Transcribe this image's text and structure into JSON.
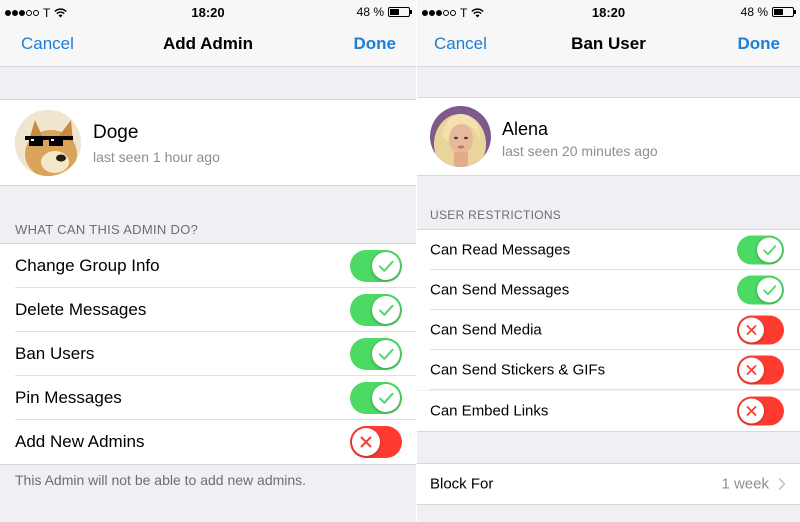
{
  "left": {
    "status": {
      "carrier": "T",
      "time": "18:20",
      "battery": "48 %"
    },
    "nav": {
      "cancel": "Cancel",
      "title": "Add Admin",
      "done": "Done"
    },
    "user": {
      "name": "Doge",
      "seen": "last seen 1 hour ago",
      "avatar": "doge-avatar"
    },
    "section_header": "WHAT CAN THIS ADMIN DO?",
    "permissions": [
      {
        "label": "Change Group Info",
        "state": "on"
      },
      {
        "label": "Delete Messages",
        "state": "on"
      },
      {
        "label": "Ban Users",
        "state": "on"
      },
      {
        "label": "Pin Messages",
        "state": "on"
      },
      {
        "label": "Add New Admins",
        "state": "off"
      }
    ],
    "footer": "This Admin will not be able to add new admins."
  },
  "right": {
    "status": {
      "carrier": "T",
      "time": "18:20",
      "battery": "48 %"
    },
    "nav": {
      "cancel": "Cancel",
      "title": "Ban User",
      "done": "Done"
    },
    "user": {
      "name": "Alena",
      "seen": "last seen 20 minutes ago",
      "avatar": "alena-avatar"
    },
    "section_header": "USER RESTRICTIONS",
    "restrictions": [
      {
        "label": "Can Read Messages",
        "state": "on"
      },
      {
        "label": "Can Send Messages",
        "state": "on"
      },
      {
        "label": "Can Send Media",
        "state": "off"
      },
      {
        "label": "Can Send Stickers & GIFs",
        "state": "off"
      },
      {
        "label": "Can Embed Links",
        "state": "off"
      }
    ],
    "block_for": {
      "label": "Block For",
      "value": "1 week"
    }
  },
  "colors": {
    "accent": "#1b7fd6",
    "toggle_on": "#4cd964",
    "toggle_off": "#ff3b30"
  },
  "icons": {
    "toggle_on": "checkmark-icon",
    "toggle_off": "cross-icon",
    "disclosure": "chevron-right-icon"
  }
}
